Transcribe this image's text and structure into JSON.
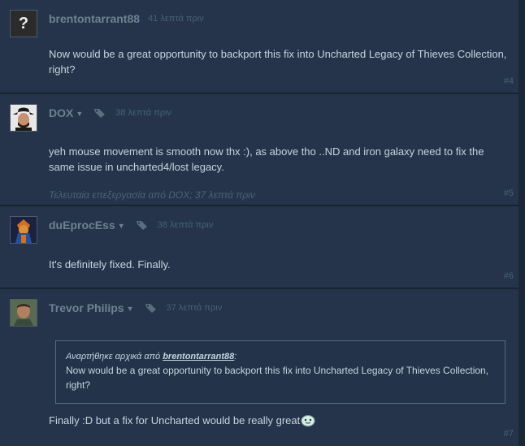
{
  "posts": [
    {
      "author": "brentontarrant88",
      "time": "41 λεπτά πριν",
      "text": "Now would be a great opportunity to backport this fix into Uncharted Legacy of Thieves Collection, right?",
      "number": "#4",
      "avatar_icon": "question-mark-avatar"
    },
    {
      "author": "DOX",
      "time": "38 λεπτά πριν",
      "text": "yeh mouse movement is smooth now thx :), as above tho ..ND and iron galaxy need to fix the same issue in uncharted4/lost legacy.",
      "edited": "Τελευταία επεξεργασία από DOX; 37 λεπτά πριν",
      "number": "#5"
    },
    {
      "author": "duEprocEss",
      "time": "38 λεπτά πριν",
      "text": "It's definitely fixed. Finally.",
      "number": "#6"
    },
    {
      "author": "Trevor Philips",
      "time": "37 λεπτά πριν",
      "quote_prefix": "Αναρτήθηκε αρχικά από ",
      "quote_author": "brentontarrant88",
      "quote_suffix": ":",
      "quote_text": "Now would be a great opportunity to backport this fix into Uncharted Legacy of Thieves Collection, right?",
      "text": "Finally :D but a fix for Uncharted would be really great",
      "number": "#7"
    }
  ],
  "colors": {
    "background": "#1b2838",
    "post": "#25344a",
    "author": "#6f8192",
    "text": "#c7d5e0"
  }
}
